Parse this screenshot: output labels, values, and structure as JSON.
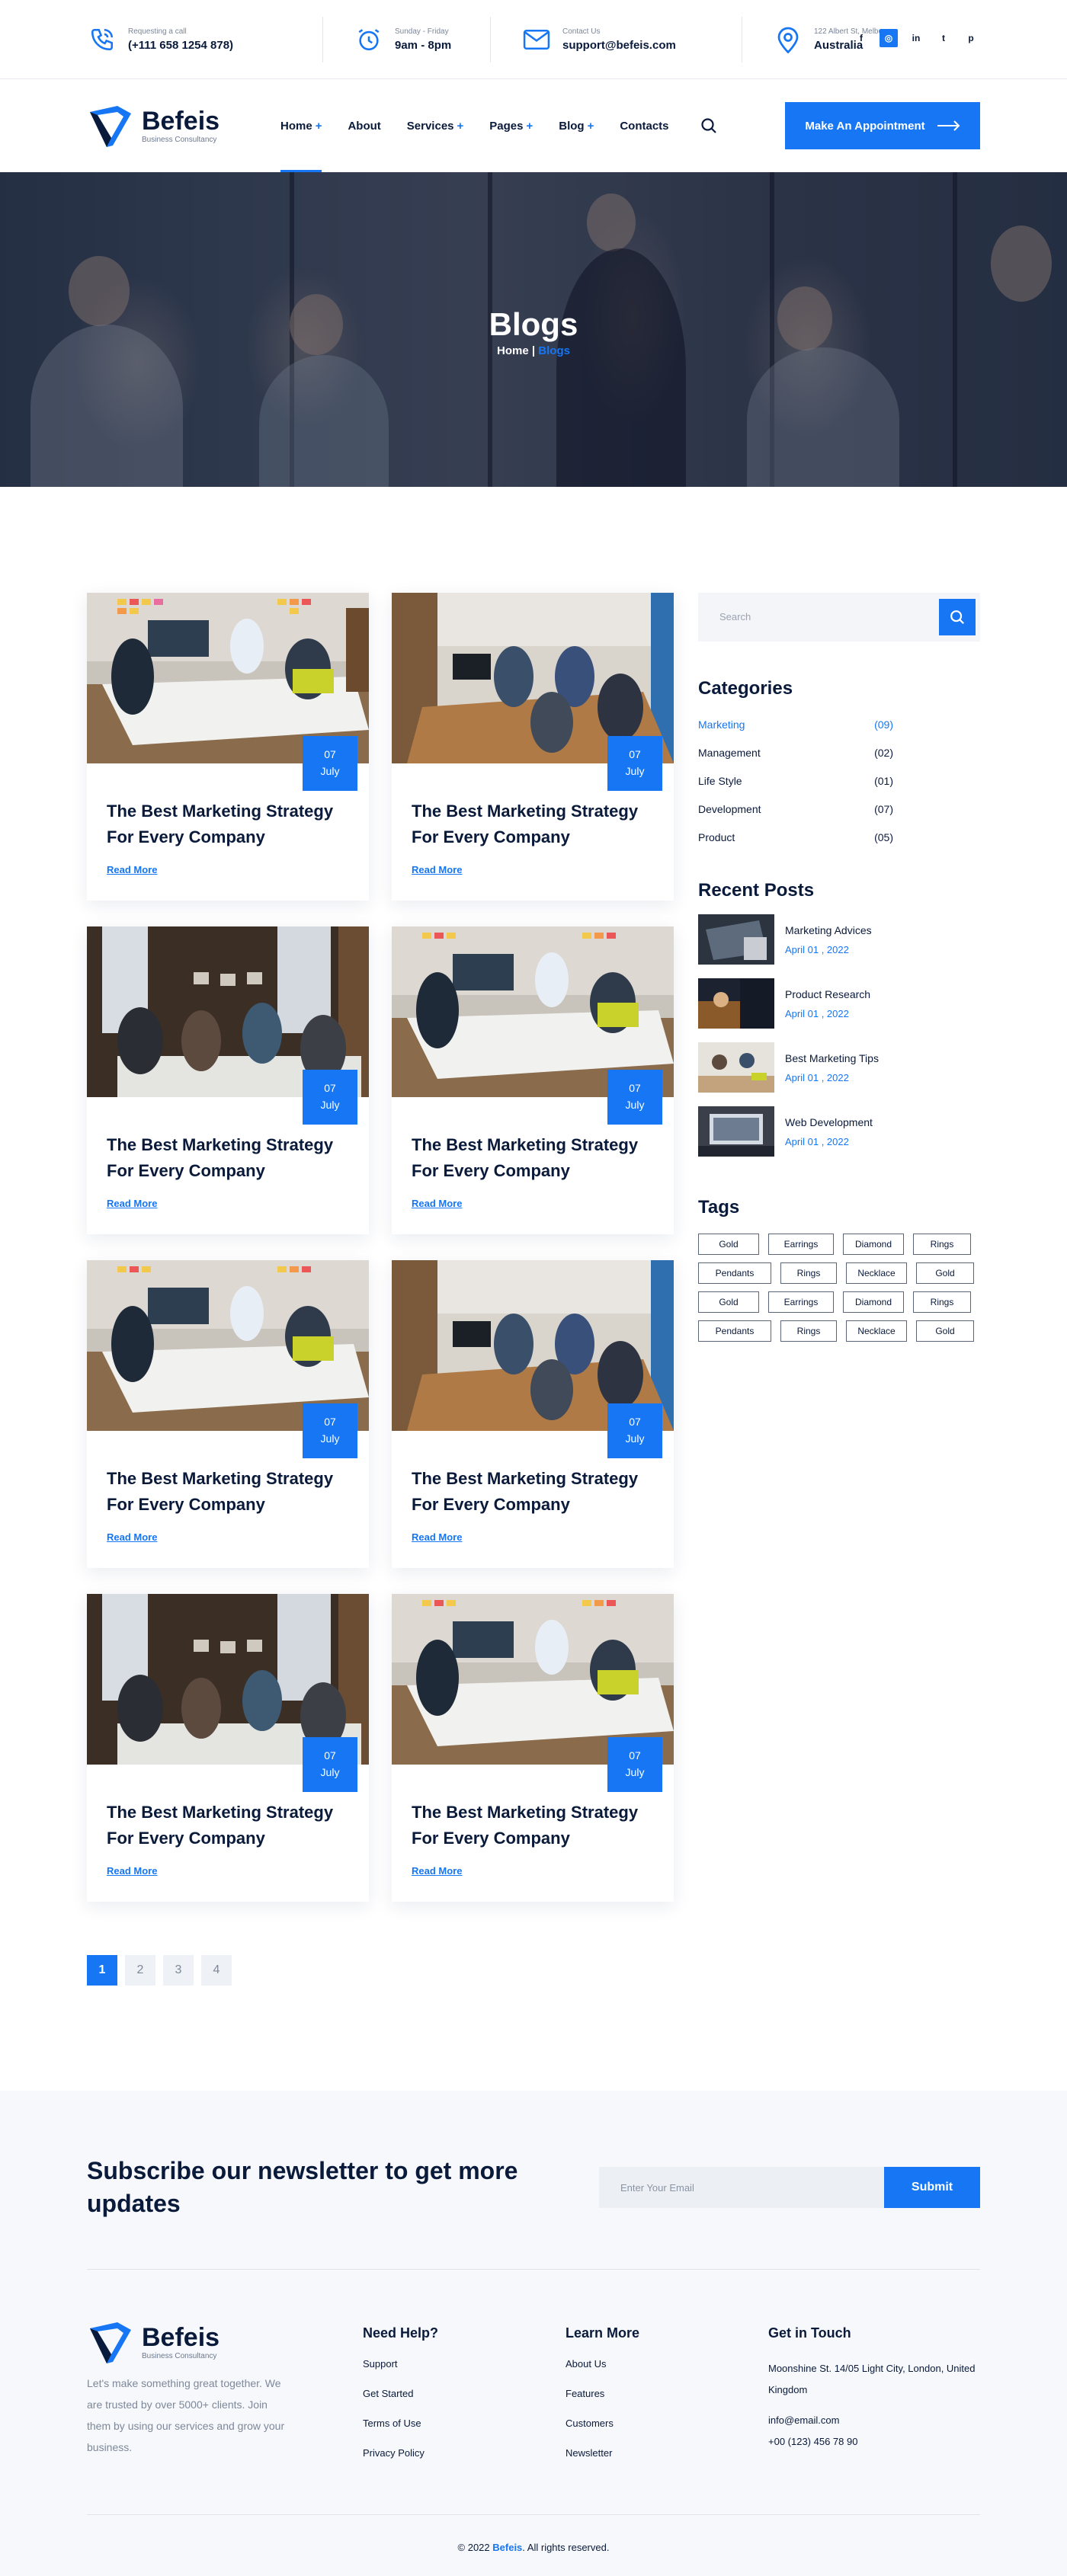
{
  "topbar": {
    "call": {
      "label": "Requesting a call",
      "value": "(+111 658 1254 878)"
    },
    "hours": {
      "label": "Sunday - Friday",
      "value": "9am - 8pm"
    },
    "contact": {
      "label": "Contact Us",
      "value": "support@befeis.com"
    },
    "address": {
      "label": "122 Albert St, Melbourne",
      "value": "Australia"
    },
    "socials": [
      "f",
      "◎",
      "in",
      "t",
      "p"
    ]
  },
  "brand": {
    "name": "Befeis",
    "tagline": "Business Consultancy"
  },
  "nav": {
    "items": [
      {
        "label": "Home",
        "plus": "+"
      },
      {
        "label": "About",
        "plus": ""
      },
      {
        "label": "Services",
        "plus": "+"
      },
      {
        "label": "Pages",
        "plus": "+"
      },
      {
        "label": "Blog",
        "plus": "+"
      },
      {
        "label": "Contacts",
        "plus": ""
      }
    ],
    "cta": "Make An Appointment"
  },
  "hero": {
    "title": "Blogs",
    "crumb_home": "Home",
    "crumb_sep": " | ",
    "crumb_current": "Blogs"
  },
  "posts": [
    {
      "day": "07",
      "month": "July",
      "title": "The Best Marketing Strategy For Every Company",
      "more": "Read More"
    },
    {
      "day": "07",
      "month": "July",
      "title": "The Best Marketing Strategy For Every Company",
      "more": "Read More"
    },
    {
      "day": "07",
      "month": "July",
      "title": "The Best Marketing Strategy For Every Company",
      "more": "Read More"
    },
    {
      "day": "07",
      "month": "July",
      "title": "The Best Marketing Strategy For Every Company",
      "more": "Read More"
    },
    {
      "day": "07",
      "month": "July",
      "title": "The Best Marketing Strategy For Every Company",
      "more": "Read More"
    },
    {
      "day": "07",
      "month": "July",
      "title": "The Best Marketing Strategy For Every Company",
      "more": "Read More"
    },
    {
      "day": "07",
      "month": "July",
      "title": "The Best Marketing Strategy For Every Company",
      "more": "Read More"
    },
    {
      "day": "07",
      "month": "July",
      "title": "The Best Marketing Strategy For Every Company",
      "more": "Read More"
    }
  ],
  "sidebar": {
    "search_placeholder": "Search",
    "categories_title": "Categories",
    "categories": [
      {
        "name": "Marketing",
        "count": "(09)"
      },
      {
        "name": "Management",
        "count": "(02)"
      },
      {
        "name": "Life Style",
        "count": "(01)"
      },
      {
        "name": "Development",
        "count": "(07)"
      },
      {
        "name": "Product",
        "count": "(05)"
      }
    ],
    "recent_title": "Recent Posts",
    "recent": [
      {
        "title": "Marketing Advices",
        "date": "April 01 , 2022"
      },
      {
        "title": "Product Research",
        "date": "April 01 , 2022"
      },
      {
        "title": "Best Marketing Tips",
        "date": "April 01 , 2022"
      },
      {
        "title": "Web Development",
        "date": "April 01 , 2022"
      }
    ],
    "tags_title": "Tags",
    "tags": [
      "Gold",
      "Earrings",
      "Diamond",
      "Rings",
      "Pendants",
      "Rings",
      "Necklace",
      "Gold",
      "Gold",
      "Earrings",
      "Diamond",
      "Rings",
      "Pendants",
      "Rings",
      "Necklace",
      "Gold"
    ]
  },
  "pagination": [
    "1",
    "2",
    "3",
    "4"
  ],
  "newsletter": {
    "title": "Subscribe our newsletter to get more updates",
    "placeholder": "Enter Your Email",
    "button": "Submit"
  },
  "footer": {
    "about": "Let's make something great together. We are trusted by over 5000+ clients. Join them by using our services and grow your business.",
    "help": {
      "title": "Need Help?",
      "links": [
        "Support",
        "Get Started",
        "Terms of Use",
        "Privacy Policy"
      ]
    },
    "learn": {
      "title": "Learn More",
      "links": [
        "About Us",
        "Features",
        "Customers",
        "Newsletter"
      ]
    },
    "touch": {
      "title": "Get in Touch",
      "address": "Moonshine St. 14/05 Light City, London, United Kingdom",
      "email": "info@email.com",
      "phone": "+00 (123) 456 78 90"
    },
    "copy_pre": "© 2022 ",
    "copy_brand": "Befeis",
    "copy_post": ". All rights reserved."
  },
  "colors": {
    "accent": "#1676f3",
    "navy": "#0a1a3a",
    "footer_bg": "#f6f8fb"
  }
}
